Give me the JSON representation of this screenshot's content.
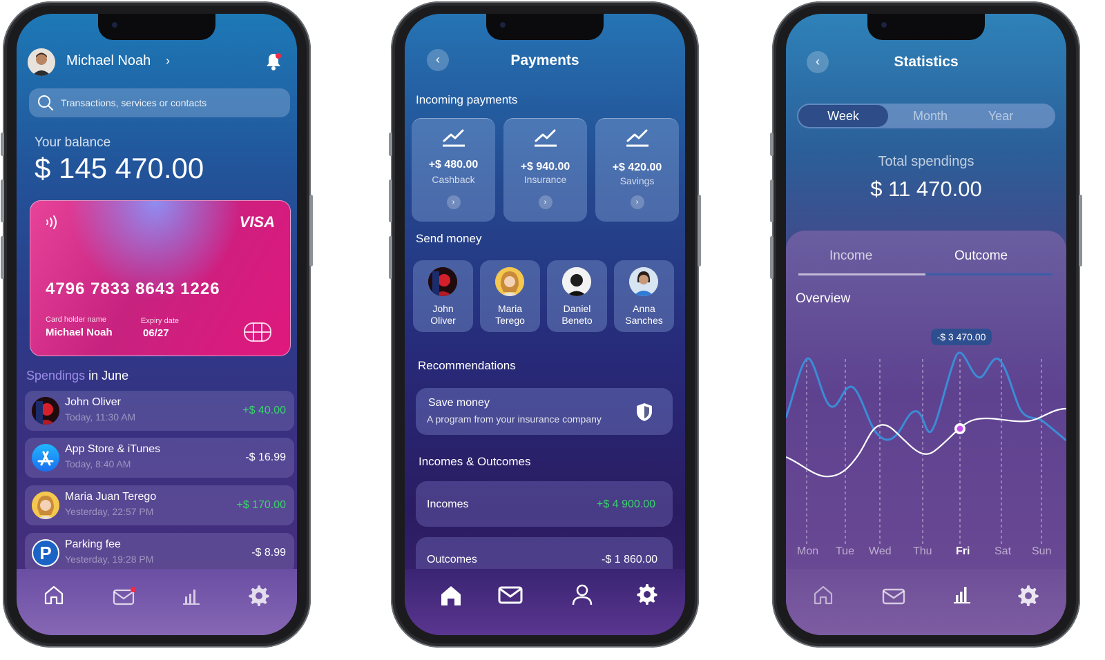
{
  "home": {
    "user_name": "Michael Noah",
    "search_placeholder": "Transactions, services or contacts",
    "balance_label": "Your balance",
    "balance": "$ 145 470.00",
    "card": {
      "brand": "VISA",
      "number": "4796 7833 8643 1226",
      "holder_label": "Card holder name",
      "holder": "Michael Noah",
      "expiry_label": "Expiry date",
      "expiry": "06/27"
    },
    "spendings_prefix": "Spendings",
    "spendings_suffix": "in June",
    "transactions": [
      {
        "name": "John Oliver",
        "date": "Today, 11:30 AM",
        "amount": "+$ 40.00",
        "positive": true
      },
      {
        "name": "App Store & iTunes",
        "date": "Today, 8:40 AM",
        "amount": "-$ 16.99",
        "positive": false
      },
      {
        "name": "Maria Juan Terego",
        "date": "Yesterday, 22:57 PM",
        "amount": "+$ 170.00",
        "positive": true
      },
      {
        "name": "Parking fee",
        "date": "Yesterday, 19:28 PM",
        "amount": "-$ 8.99",
        "positive": false
      }
    ]
  },
  "payments": {
    "title": "Payments",
    "incoming_heading": "Incoming payments",
    "incoming": [
      {
        "amount": "+$ 480.00",
        "label": "Cashback"
      },
      {
        "amount": "+$ 940.00",
        "label": "Insurance"
      },
      {
        "amount": "+$ 420.00",
        "label": "Savings"
      }
    ],
    "send_heading": "Send money",
    "contacts": [
      "John\nOliver",
      "Maria\nTerego",
      "Daniel\nBeneto",
      "Anna\nSanches"
    ],
    "recommend_heading": "Recommendations",
    "recommend_title": "Save money",
    "recommend_sub": "A program from your insurance company",
    "io_heading": "Incomes & Outcomes",
    "incomes_label": "Incomes",
    "incomes_value": "+$ 4 900.00",
    "outcomes_label": "Outcomes",
    "outcomes_value": "-$ 1 860.00"
  },
  "statistics": {
    "title": "Statistics",
    "periods": [
      "Week",
      "Month",
      "Year"
    ],
    "total_label": "Total spendings",
    "total": "$ 11 470.00",
    "tabs": [
      "Income",
      "Outcome"
    ],
    "overview_label": "Overview",
    "tooltip": "-$ 3 470.00",
    "days": [
      "Mon",
      "Tue",
      "Wed",
      "Thu",
      "Fri",
      "Sat",
      "Sun"
    ]
  },
  "colors": {
    "positive": "#39d46a",
    "card_pink": "#e0187e",
    "accent_purple": "#c94ef0"
  }
}
